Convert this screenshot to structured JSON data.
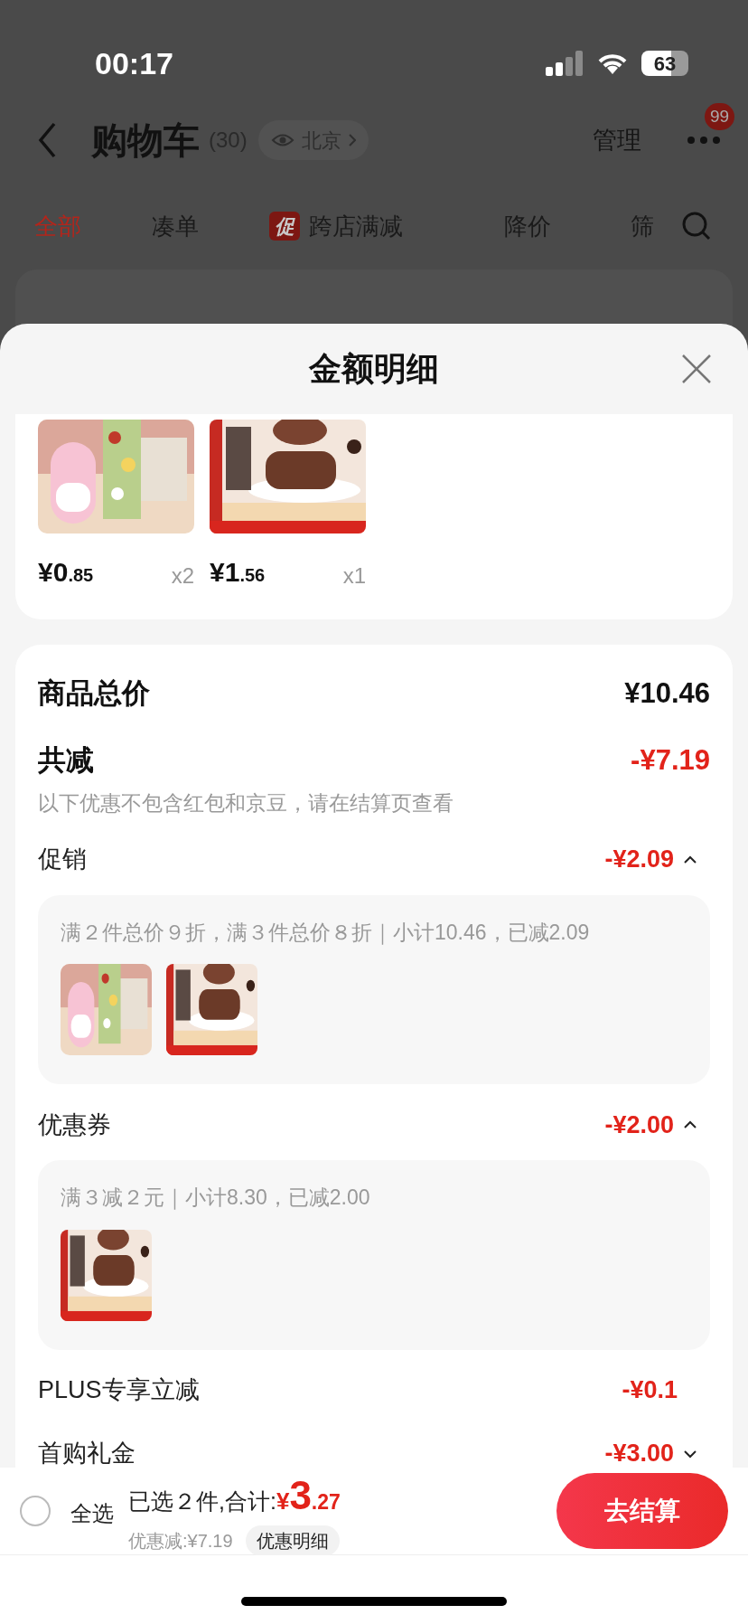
{
  "status_bar": {
    "time": "00:17",
    "battery": "63"
  },
  "header": {
    "title": "购物车",
    "count": "(30)",
    "location": "北京",
    "manage": "管理",
    "badge": "99"
  },
  "tabs": [
    {
      "label": "全部",
      "selected": true
    },
    {
      "label": "凑单",
      "selected": false
    },
    {
      "label": "跨店满减",
      "tag": "促",
      "selected": false
    },
    {
      "label": "降价",
      "selected": false
    },
    {
      "label": "筛",
      "selected": false
    }
  ],
  "sheet": {
    "title": "金额明细",
    "products": [
      {
        "kind": "picture",
        "price_int": "¥0",
        "price_dec": ".85",
        "qty": "x2"
      },
      {
        "kind": "picture",
        "price_int": "¥1",
        "price_dec": ".56",
        "qty": "x1"
      }
    ],
    "total": {
      "label": "商品总价",
      "value": "¥10.46"
    },
    "discount": {
      "label": "共减",
      "value": "-¥7.19",
      "note": "以下优惠不包含红包和京豆，请在结算页查看"
    },
    "sections": [
      {
        "label": "促销",
        "value": "-¥2.09",
        "expanded": true,
        "detail": "满２件总价９折，满３件总价８折｜小计10.46，已减2.09",
        "thumbs": [
          {
            "kind": "sticker"
          },
          {
            "kind": "wafer"
          }
        ]
      },
      {
        "label": "优惠券",
        "value": "-¥2.00",
        "expanded": true,
        "detail": "满３减２元｜小计8.30，已减2.00",
        "thumbs": [
          {
            "kind": "wafer"
          }
        ]
      },
      {
        "label": "PLUS专享立减",
        "value": "-¥0.1"
      },
      {
        "label": "首购礼金",
        "value": "-¥3.00",
        "expanded": false
      }
    ]
  },
  "bottom_bar": {
    "select_all": {
      "label": "全选",
      "checked": false
    },
    "selected_text": "已选２件,合计:",
    "total_int": "¥3",
    "total_dec": ".27",
    "saved": "优惠减:¥7.19",
    "detail_button": "优惠明细",
    "checkout": "去结算"
  }
}
